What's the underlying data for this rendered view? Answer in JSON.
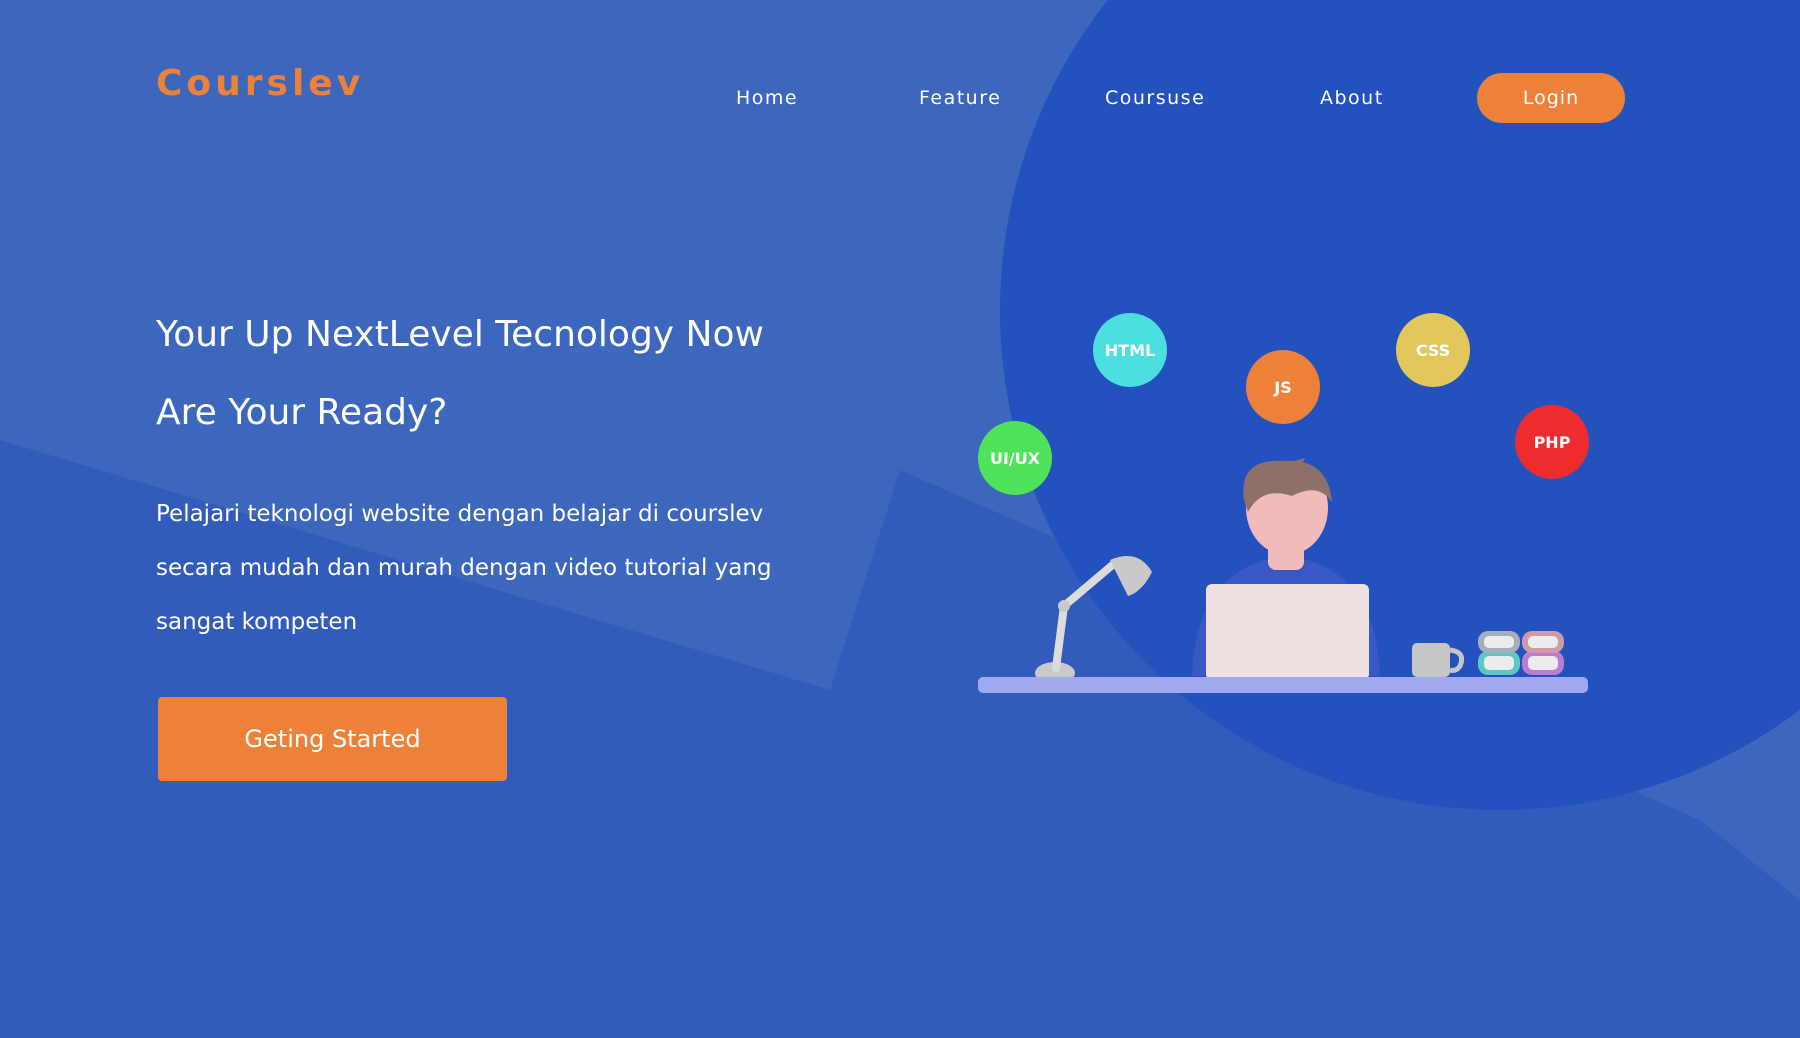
{
  "brand": {
    "name": "Courslev",
    "accent_color": "#ed813a",
    "background_color": "#325cbc"
  },
  "nav": {
    "items": [
      {
        "label": "Home"
      },
      {
        "label": "Feature"
      },
      {
        "label": "Coursuse"
      },
      {
        "label": "About"
      }
    ],
    "login_label": "Login"
  },
  "hero": {
    "title_lines": [
      "Your Up NextLevel Tecnology Now",
      "Are Your Ready?"
    ],
    "description_lines": [
      "Pelajari teknologi website dengan belajar di courslev",
      "secara mudah dan murah dengan video tutorial yang",
      "sangat kompeten"
    ],
    "cta_label": "Geting Started"
  },
  "illustration": {
    "tech_bubbles": [
      {
        "label": "UI/UX",
        "color": "#4fe35b"
      },
      {
        "label": "HTML",
        "color": "#4ddedf"
      },
      {
        "label": "JS",
        "color": "#ed813a"
      },
      {
        "label": "CSS",
        "color": "#e1c75c"
      },
      {
        "label": "PHP",
        "color": "#ee2c2e"
      }
    ]
  }
}
